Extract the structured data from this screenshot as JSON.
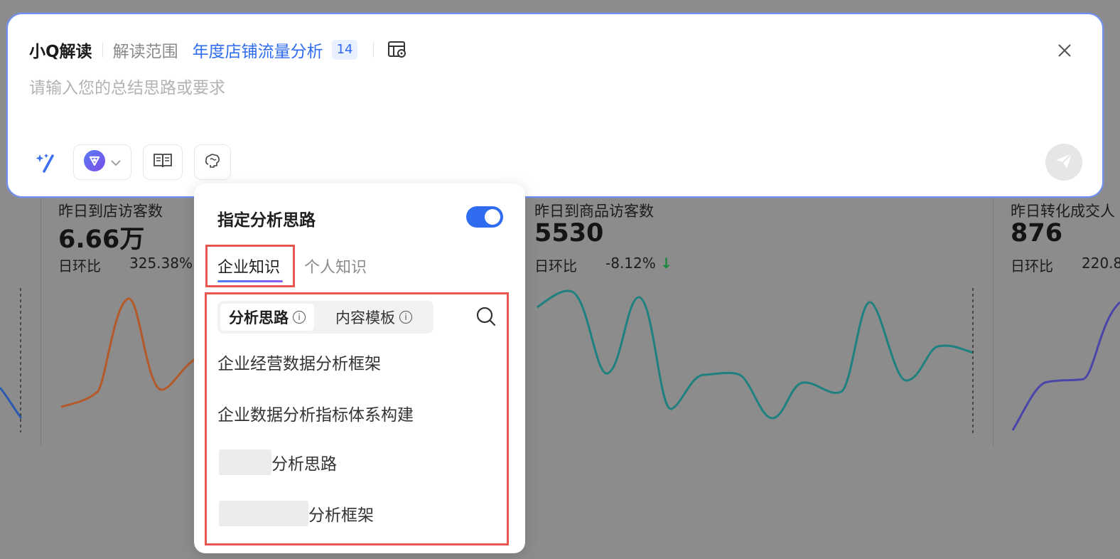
{
  "panel": {
    "title": "小Q解读",
    "scope_label": "解读范围",
    "scope_link": "年度店铺流量分析",
    "scope_count": "14",
    "input_placeholder": "请输入您的总结思路或要求"
  },
  "dashboard": {
    "cards": [
      {
        "title": "昨日到店访客数",
        "value": "6.66万",
        "ratio_label": "日环比",
        "ratio_value": "325.38%"
      },
      {
        "title": "昨日到商品访客数",
        "value": "5530",
        "ratio_label": "日环比",
        "ratio_value": "-8.12%"
      },
      {
        "title": "昨日转化成交人",
        "value": "876",
        "ratio_label": "日环比",
        "ratio_value": "220.8"
      }
    ],
    "colors": {
      "orange": "#b45a2a",
      "teal": "#1f8080",
      "indigo": "#4a45a8",
      "blue": "#2a5ab0"
    }
  },
  "dropdown": {
    "title": "指定分析思路",
    "toggle_on": true,
    "tabs": [
      "企业知识",
      "个人知识"
    ],
    "segments": [
      "分析思路",
      "内容模板"
    ],
    "items": [
      "企业经营数据分析框架",
      "企业数据分析指标体系构建",
      "分析思路",
      "分析框架"
    ]
  },
  "icons": {
    "layout": "table-settings-icon",
    "close": "close-icon",
    "magic": "sparkle-pen-icon",
    "model": "model-logo-icon",
    "book": "book-icon",
    "brain": "brain-icon",
    "send": "send-icon",
    "search": "search-icon",
    "info": "info-icon"
  },
  "accent": "#2f6cf0"
}
